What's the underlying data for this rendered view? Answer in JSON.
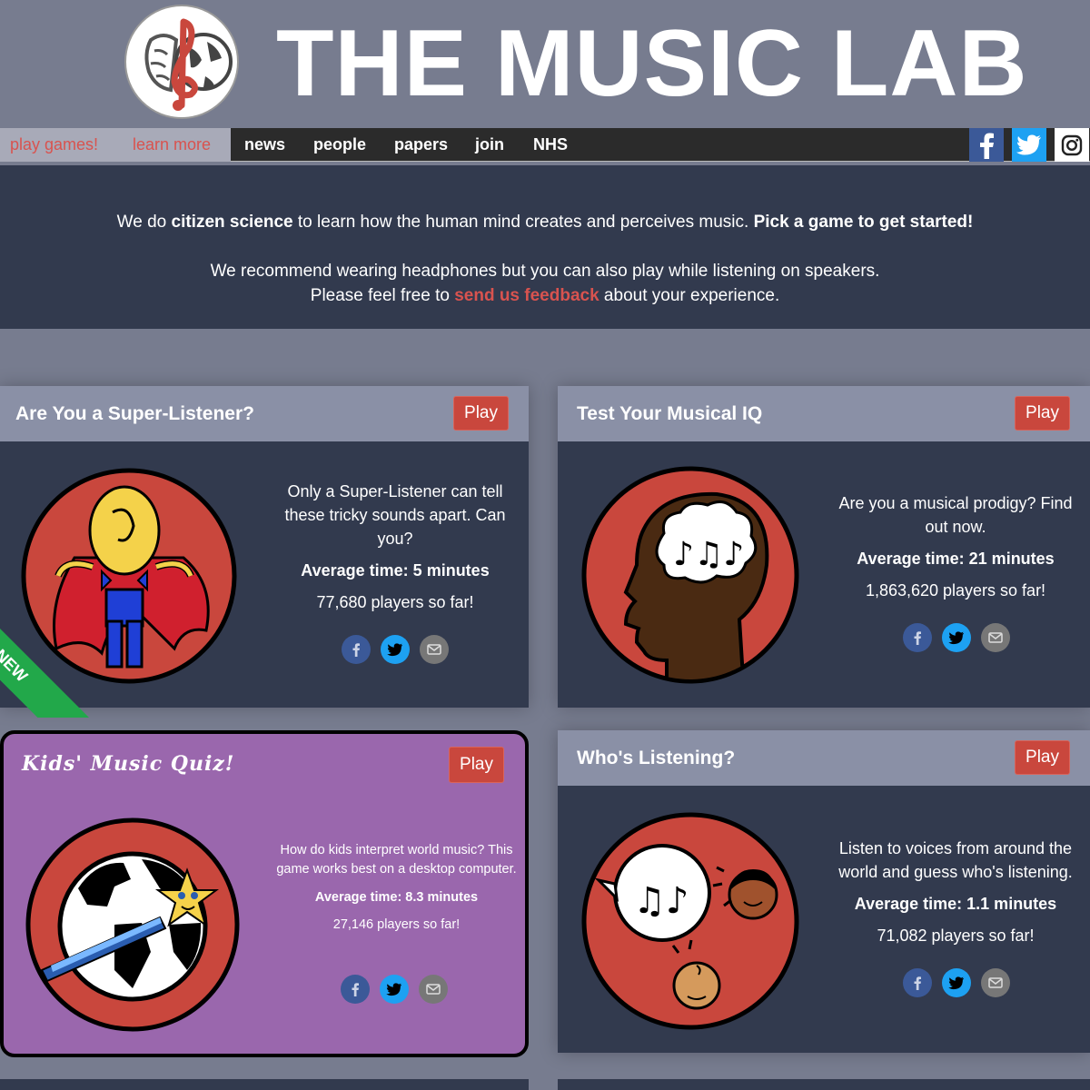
{
  "header": {
    "title": "THE MUSIC LAB"
  },
  "nav": {
    "play_games": "play games!",
    "learn_more": "learn more",
    "items": [
      "news",
      "people",
      "papers",
      "join",
      "NHS"
    ]
  },
  "intro": {
    "line1_pre": "We do ",
    "line1_bold1": "citizen science",
    "line1_mid": " to learn how the human mind creates and perceives music. ",
    "line1_bold2": "Pick a game to get started!",
    "line2": "We recommend wearing headphones but you can also play while listening on speakers.",
    "line3_pre": "Please feel free to ",
    "line3_link": "send us feedback",
    "line3_post": " about your experience."
  },
  "cards": [
    {
      "title": "Are You a Super-Listener?",
      "play": "Play",
      "desc": "Only a Super-Listener can tell these tricky sounds apart. Can you?",
      "avg": "Average time: 5 minutes",
      "players": "77,680 players so far!",
      "ribbon": "NEW"
    },
    {
      "title": "Test Your Musical IQ",
      "play": "Play",
      "desc": "Are you a musical prodigy? Find out now.",
      "avg": "Average time: 21 minutes",
      "players": "1,863,620 players so far!"
    },
    {
      "title": "Kids' Music Quiz!",
      "play": "Play",
      "desc": "How do kids interpret world music? This game works best on a desktop computer.",
      "avg": "Average time: 8.3 minutes",
      "players": "27,146 players so far!"
    },
    {
      "title": "Who's Listening?",
      "play": "Play",
      "desc": "Listen to voices from around the world and guess who's listening.",
      "avg": "Average time: 1.1 minutes",
      "players": "71,082 players so far!"
    }
  ],
  "colors": {
    "page_bg": "#777c8f",
    "card_bg": "#323a4e",
    "card_head": "#8a90a6",
    "accent_red": "#c9473d",
    "kids_bg": "#9a67ad",
    "ribbon_green": "#22a84a"
  }
}
